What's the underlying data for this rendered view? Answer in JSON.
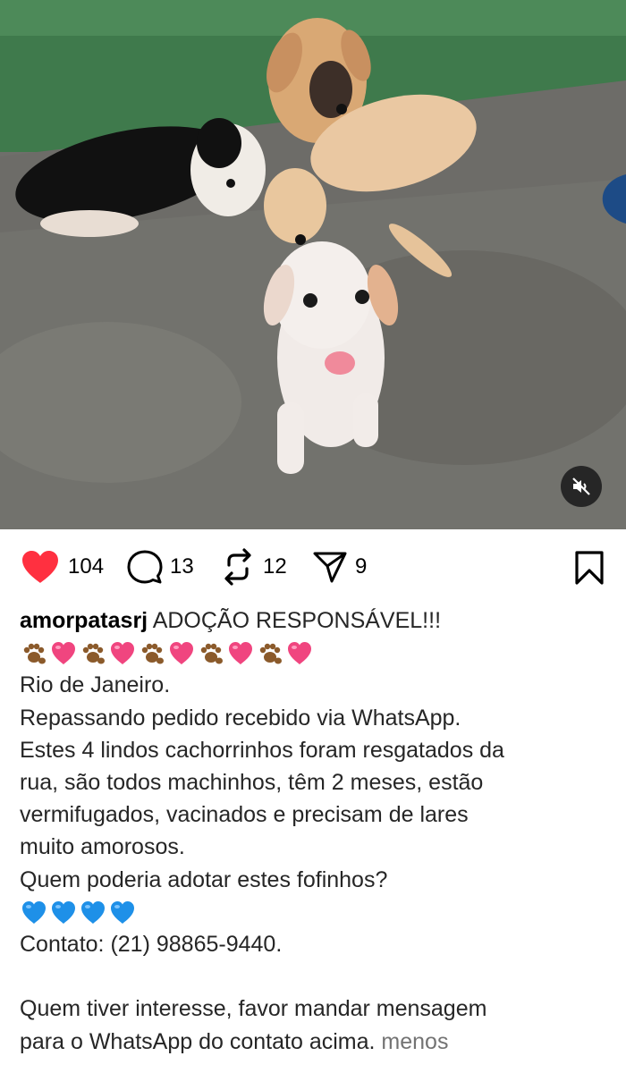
{
  "post": {
    "media": {
      "description_icon": "puppies-photo",
      "mute_icon": "speaker-muted-icon"
    },
    "actions": {
      "likes": "104",
      "comments": "13",
      "reposts": "12",
      "shares": "9",
      "like_color": "#ff3040"
    },
    "caption": {
      "username": "amorpatasrj",
      "headline": "ADOÇÃO RESPONSÁVEL!!!",
      "emoji_row_1": [
        "paw",
        "heart",
        "paw",
        "heart",
        "paw",
        "heart",
        "paw",
        "heart",
        "paw",
        "heart"
      ],
      "line_location": "Rio de Janeiro.",
      "line_2": "Repassando pedido recebido via WhatsApp.",
      "line_3": "Estes 4 lindos cachorrinhos foram resgatados da",
      "line_4": "rua, são todos machinhos, têm 2 meses, estão",
      "line_5": "vermifugados, vacinados e precisam de lares",
      "line_6": "muito amorosos.",
      "line_7": "Quem poderia adotar estes fofinhos?",
      "emoji_row_2": [
        "blue-heart",
        "blue-heart",
        "blue-heart",
        "blue-heart"
      ],
      "line_contact": "Contato: (21) 98865-9440.",
      "line_9": "Quem tiver interesse, favor mandar mensagem",
      "line_10_prefix": "para o WhatsApp do contato acima.",
      "less_link": "menos"
    }
  }
}
